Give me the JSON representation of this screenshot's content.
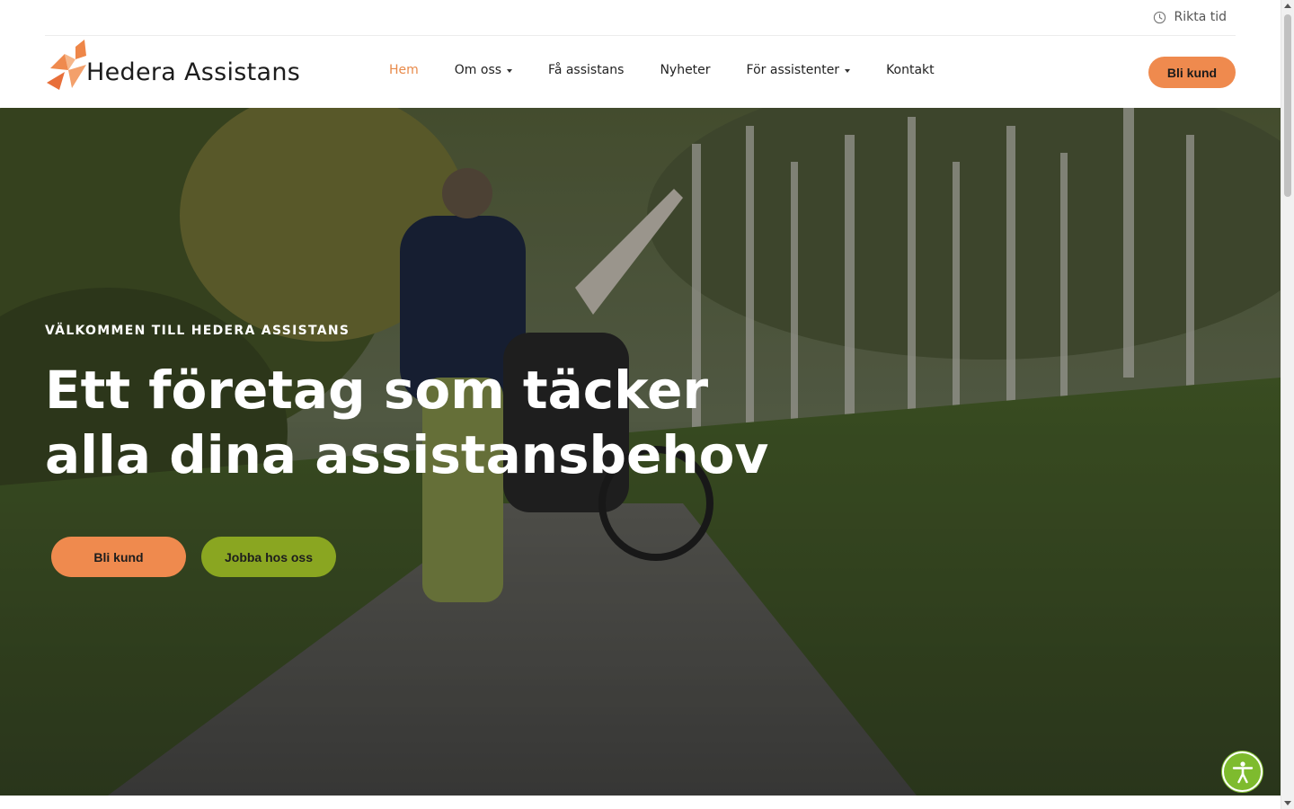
{
  "topbar": {
    "link_label": "Rikta tid",
    "icon": "clock-icon"
  },
  "brand": {
    "name": "Hedera Assistans",
    "accent": "#ef8a4e"
  },
  "nav": {
    "items": [
      {
        "label": "Hem",
        "active": true,
        "has_dropdown": false
      },
      {
        "label": "Om oss",
        "active": false,
        "has_dropdown": true
      },
      {
        "label": "Få assistans",
        "active": false,
        "has_dropdown": false
      },
      {
        "label": "Nyheter",
        "active": false,
        "has_dropdown": false
      },
      {
        "label": "För assistenter",
        "active": false,
        "has_dropdown": true
      },
      {
        "label": "Kontakt",
        "active": false,
        "has_dropdown": false
      }
    ],
    "cta_label": "Bli kund"
  },
  "hero": {
    "kicker": "VÄLKOMMEN TILL HEDERA ASSISTANS",
    "title": "Ett företag som täcker alla dina assistansbehov",
    "primary_button": "Bli kund",
    "secondary_button": "Jobba hos oss",
    "primary_color": "#ef8a4e",
    "secondary_color": "#8aa621"
  },
  "accessibility": {
    "icon": "accessibility-icon",
    "color": "#7ebb2e"
  }
}
